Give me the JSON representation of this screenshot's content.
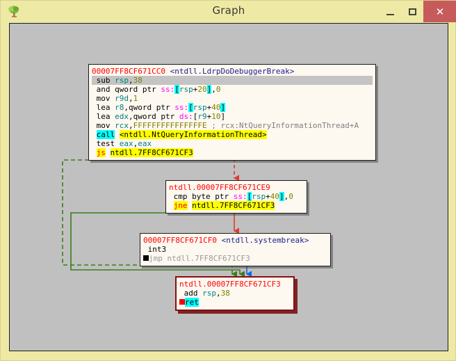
{
  "window": {
    "title": "Graph",
    "icon": "tree-icon",
    "minimize_label": "–",
    "maximize_label": "□",
    "close_label": "✕",
    "titlebar_color": "#eeeaa6",
    "close_color": "#c75b5b"
  },
  "canvas": {
    "background": "#c0c0c0"
  },
  "graph": {
    "nodes": [
      {
        "id": "node-entry",
        "header": {
          "address": "00007FF8CF671CC0",
          "symbol": "<ntdll.LdrpDoDebuggerBreak>"
        },
        "lines": [
          {
            "selected": true,
            "breakpoint": "",
            "mnemonic": "sub",
            "operands_plain": "rsp,38",
            "tokens": [
              {
                "t": "mn",
                "v": "sub "
              },
              {
                "t": "reg",
                "v": "rsp"
              },
              {
                "t": "mn",
                "v": ","
              },
              {
                "t": "num",
                "v": "38"
              }
            ]
          },
          {
            "selected": false,
            "breakpoint": "",
            "mnemonic": "and",
            "operands_plain": "qword ptr ss:[rsp+20],0",
            "tokens": [
              {
                "t": "mn",
                "v": "and qword ptr "
              },
              {
                "t": "seg",
                "v": "ss:"
              },
              {
                "t": "brk",
                "v": "["
              },
              {
                "t": "reg",
                "v": "rsp"
              },
              {
                "t": "mn",
                "v": "+"
              },
              {
                "t": "num",
                "v": "20"
              },
              {
                "t": "brk",
                "v": "]"
              },
              {
                "t": "mn",
                "v": ","
              },
              {
                "t": "num",
                "v": "0"
              }
            ]
          },
          {
            "selected": false,
            "breakpoint": "",
            "mnemonic": "mov",
            "operands_plain": "r9d,1",
            "tokens": [
              {
                "t": "mn",
                "v": "mov "
              },
              {
                "t": "reg",
                "v": "r9d"
              },
              {
                "t": "mn",
                "v": ","
              },
              {
                "t": "num",
                "v": "1"
              }
            ]
          },
          {
            "selected": false,
            "breakpoint": "",
            "mnemonic": "lea",
            "operands_plain": "r8,qword ptr ss:[rsp+40]",
            "tokens": [
              {
                "t": "mn",
                "v": "lea "
              },
              {
                "t": "reg",
                "v": "r8"
              },
              {
                "t": "mn",
                "v": ",qword ptr "
              },
              {
                "t": "seg",
                "v": "ss:"
              },
              {
                "t": "brk",
                "v": "["
              },
              {
                "t": "reg",
                "v": "rsp"
              },
              {
                "t": "mn",
                "v": "+"
              },
              {
                "t": "num",
                "v": "40"
              },
              {
                "t": "brk",
                "v": "]"
              }
            ]
          },
          {
            "selected": false,
            "breakpoint": "",
            "mnemonic": "lea",
            "operands_plain": "edx,qword ptr ds:[r9+10]",
            "tokens": [
              {
                "t": "mn",
                "v": "lea "
              },
              {
                "t": "reg",
                "v": "edx"
              },
              {
                "t": "mn",
                "v": ",qword ptr "
              },
              {
                "t": "seg",
                "v": "ds:"
              },
              {
                "t": "mn",
                "v": "["
              },
              {
                "t": "reg",
                "v": "r9"
              },
              {
                "t": "mn",
                "v": "+"
              },
              {
                "t": "num",
                "v": "10"
              },
              {
                "t": "mn",
                "v": "]"
              }
            ]
          },
          {
            "selected": false,
            "breakpoint": "",
            "mnemonic": "mov",
            "operands_plain": "rcx,FFFFFFFFFFFFFFFE ; rcx:NtQueryInformationThread+A",
            "tokens": [
              {
                "t": "mn",
                "v": "mov "
              },
              {
                "t": "reg",
                "v": "rcx"
              },
              {
                "t": "mn",
                "v": ","
              },
              {
                "t": "num",
                "v": "FFFFFFFFFFFFFFFE"
              },
              {
                "t": "cmt",
                "v": " ; rcx:NtQueryInformationThread+A"
              }
            ]
          },
          {
            "selected": false,
            "breakpoint": "",
            "mnemonic": "call",
            "operands_plain": "<ntdll.NtQueryInformationThread>",
            "tokens": [
              {
                "t": "call-hl",
                "v": "call"
              },
              {
                "t": "mn",
                "v": " "
              },
              {
                "t": "jmp-y",
                "v": "<ntdll.NtQueryInformationThread>"
              }
            ]
          },
          {
            "selected": false,
            "breakpoint": "",
            "mnemonic": "test",
            "operands_plain": "eax,eax",
            "tokens": [
              {
                "t": "mn",
                "v": "test "
              },
              {
                "t": "reg",
                "v": "eax"
              },
              {
                "t": "mn",
                "v": ","
              },
              {
                "t": "reg",
                "v": "eax"
              }
            ]
          },
          {
            "selected": false,
            "breakpoint": "",
            "mnemonic": "js",
            "operands_plain": "ntdll.7FF8CF671CF3",
            "tokens": [
              {
                "t": "jcc",
                "v": "js"
              },
              {
                "t": "mn",
                "v": " "
              },
              {
                "t": "jmp-y",
                "v": "ntdll.7FF8CF671CF3"
              }
            ]
          }
        ]
      },
      {
        "id": "node-cmp",
        "header": {
          "address": "ntdll.00007FF8CF671CE9",
          "symbol": ""
        },
        "lines": [
          {
            "selected": false,
            "breakpoint": "",
            "mnemonic": "cmp",
            "operands_plain": "byte ptr ss:[rsp+40],0",
            "tokens": [
              {
                "t": "mn",
                "v": "cmp byte ptr "
              },
              {
                "t": "seg",
                "v": "ss:"
              },
              {
                "t": "brk",
                "v": "["
              },
              {
                "t": "reg",
                "v": "rsp"
              },
              {
                "t": "mn",
                "v": "+"
              },
              {
                "t": "num",
                "v": "40"
              },
              {
                "t": "brk",
                "v": "]"
              },
              {
                "t": "mn",
                "v": ","
              },
              {
                "t": "num",
                "v": "0"
              }
            ]
          },
          {
            "selected": false,
            "breakpoint": "",
            "mnemonic": "jne",
            "operands_plain": "ntdll.7FF8CF671CF3",
            "tokens": [
              {
                "t": "jcc",
                "v": "jne"
              },
              {
                "t": "mn",
                "v": " "
              },
              {
                "t": "jmp-y",
                "v": "ntdll.7FF8CF671CF3"
              }
            ]
          }
        ]
      },
      {
        "id": "node-systembreak",
        "header": {
          "address": "00007FF8CF671CF0",
          "symbol": "<ntdll.systembreak>"
        },
        "lines": [
          {
            "selected": false,
            "breakpoint": "",
            "mnemonic": "int3",
            "operands_plain": "",
            "tokens": [
              {
                "t": "mn",
                "v": "int3"
              }
            ]
          },
          {
            "selected": false,
            "breakpoint": "black",
            "mnemonic": "jmp",
            "operands_plain": "ntdll.7FF8CF671CF3",
            "tokens": [
              {
                "t": "grey",
                "v": "jmp ntdll.7FF8CF671CF3"
              }
            ]
          }
        ]
      },
      {
        "id": "node-ret",
        "header": {
          "address": "ntdll.00007FF8CF671CF3",
          "symbol": ""
        },
        "lines": [
          {
            "selected": false,
            "breakpoint": "",
            "mnemonic": "add",
            "operands_plain": "rsp,38",
            "tokens": [
              {
                "t": "mn",
                "v": "add "
              },
              {
                "t": "reg",
                "v": "rsp"
              },
              {
                "t": "mn",
                "v": ","
              },
              {
                "t": "num",
                "v": "38"
              }
            ]
          },
          {
            "selected": false,
            "breakpoint": "red",
            "mnemonic": "ret",
            "operands_plain": "",
            "tokens": [
              {
                "t": "ret-hl",
                "v": "ret"
              }
            ]
          }
        ]
      }
    ],
    "edges": [
      {
        "from": "node-entry",
        "to": "node-cmp",
        "kind": "fallthrough",
        "color": "#e03a2f",
        "style": "dashed"
      },
      {
        "from": "node-entry",
        "to": "node-ret",
        "kind": "taken-js",
        "color": "#3a7d1e",
        "style": "dashed"
      },
      {
        "from": "node-cmp",
        "to": "node-systembreak",
        "kind": "fallthrough",
        "color": "#e03a2f",
        "style": "solid"
      },
      {
        "from": "node-cmp",
        "to": "node-ret",
        "kind": "taken-jne",
        "color": "#3a7d1e",
        "style": "solid"
      },
      {
        "from": "node-systembreak",
        "to": "node-ret",
        "kind": "unconditional",
        "color": "#1565e0",
        "style": "solid"
      }
    ],
    "colors": {
      "address": "#ff0000",
      "symbol": "#1c1c8c",
      "register": "#008080",
      "number": "#808000",
      "segment": "#ff00ff",
      "comment": "#808080",
      "highlight_yellow": "#ffff00",
      "highlight_cyan": "#00ffff",
      "node_background": "#fdf8f0",
      "edge_taken": "#3a7d1e",
      "edge_fallthrough": "#e03a2f",
      "edge_unconditional": "#1565e0"
    }
  }
}
